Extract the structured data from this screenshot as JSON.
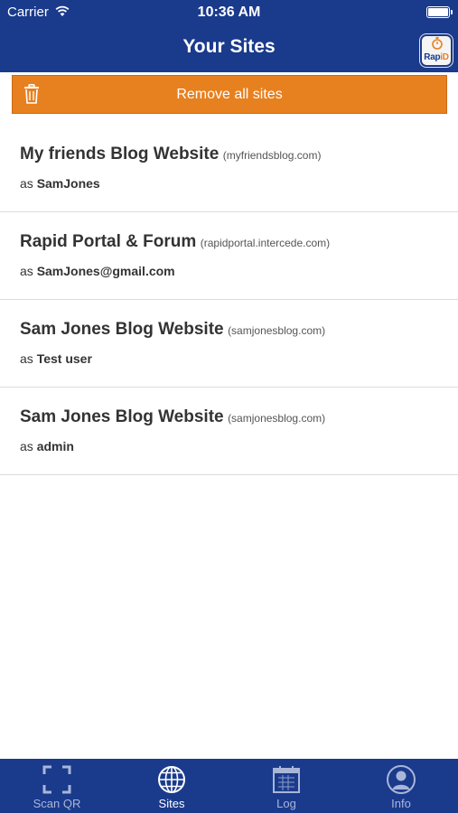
{
  "status_bar": {
    "carrier": "Carrier",
    "time": "10:36 AM"
  },
  "header": {
    "title": "Your Sites",
    "logo_text_a": "Rap",
    "logo_text_b": "iD"
  },
  "remove_all": {
    "label": "Remove all sites"
  },
  "sites": [
    {
      "name": "My friends Blog Website",
      "domain": "(myfriendsblog.com)",
      "as_prefix": "as",
      "user": "SamJones"
    },
    {
      "name": "Rapid Portal & Forum",
      "domain": "(rapidportal.intercede.com)",
      "as_prefix": "as",
      "user": "SamJones@gmail.com"
    },
    {
      "name": "Sam Jones Blog Website",
      "domain": "(samjonesblog.com)",
      "as_prefix": "as",
      "user": "Test user"
    },
    {
      "name": "Sam Jones Blog Website",
      "domain": "(samjonesblog.com)",
      "as_prefix": "as",
      "user": "admin"
    }
  ],
  "tabs": [
    {
      "label": "Scan QR",
      "icon": "scan-qr-icon",
      "active": false
    },
    {
      "label": "Sites",
      "icon": "globe-icon",
      "active": true
    },
    {
      "label": "Log",
      "icon": "calendar-icon",
      "active": false
    },
    {
      "label": "Info",
      "icon": "person-icon",
      "active": false
    }
  ],
  "colors": {
    "navy": "#1a3a8c",
    "orange": "#e7801f",
    "tab_inactive": "#a9b6d8"
  }
}
